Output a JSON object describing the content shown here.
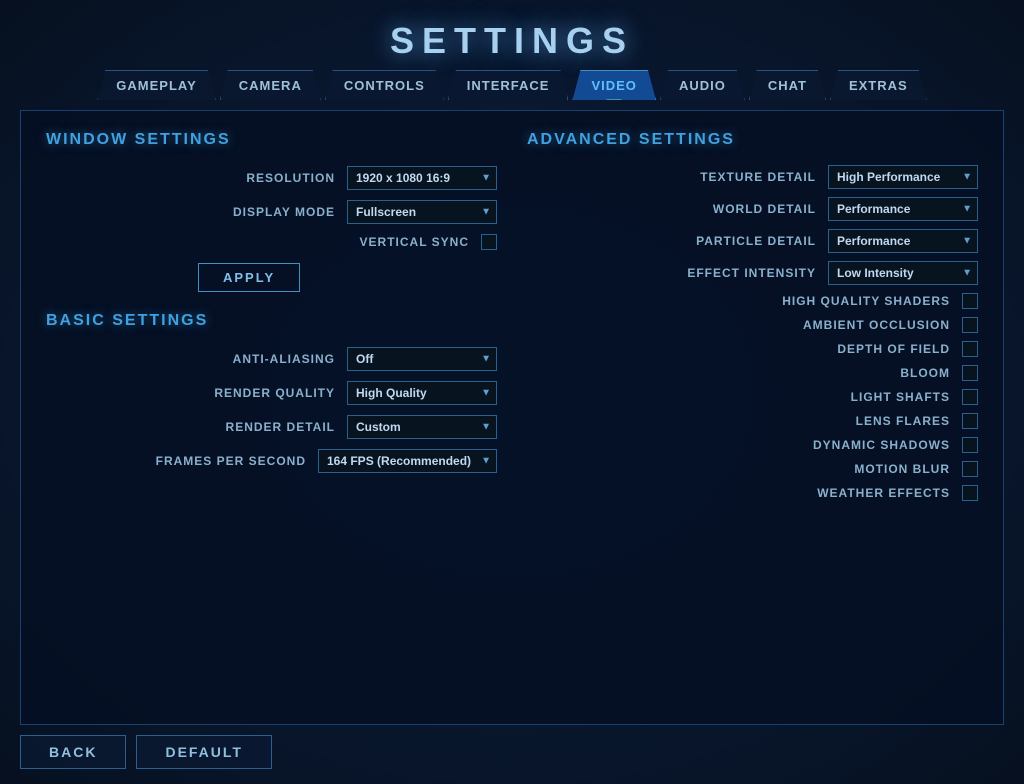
{
  "title": "SETTINGS",
  "tabs": [
    {
      "id": "gameplay",
      "label": "GAMEPLAY",
      "active": false
    },
    {
      "id": "camera",
      "label": "CAMERA",
      "active": false
    },
    {
      "id": "controls",
      "label": "CONTROLS",
      "active": false
    },
    {
      "id": "interface",
      "label": "INTERFACE",
      "active": false
    },
    {
      "id": "video",
      "label": "VIDEO",
      "active": true
    },
    {
      "id": "audio",
      "label": "AUDIO",
      "active": false
    },
    {
      "id": "chat",
      "label": "CHAT",
      "active": false
    },
    {
      "id": "extras",
      "label": "EXTRAS",
      "active": false
    }
  ],
  "windowSettings": {
    "header": "WINDOW SETTINGS",
    "resolution": {
      "label": "RESOLUTION",
      "value": "1920 x 1080 16:9"
    },
    "displayMode": {
      "label": "DISPLAY MODE",
      "value": "Fullscreen"
    },
    "verticalSync": {
      "label": "VERTICAL SYNC",
      "checked": false
    },
    "applyButton": "APPLY"
  },
  "basicSettings": {
    "header": "BASIC SETTINGS",
    "antiAliasing": {
      "label": "ANTI-ALIASING",
      "value": "Off"
    },
    "renderQuality": {
      "label": "RENDER QUALITY",
      "value": "High Quality"
    },
    "renderDetail": {
      "label": "RENDER DETAIL",
      "value": "Custom"
    },
    "framesPerSecond": {
      "label": "FRAMES PER SECOND",
      "value": "164  FPS (Recommended)"
    }
  },
  "advancedSettings": {
    "header": "ADVANCED SETTINGS",
    "textureDetail": {
      "label": "TEXTURE DETAIL",
      "value": "High Performance"
    },
    "worldDetail": {
      "label": "WORLD DETAIL",
      "value": "Performance"
    },
    "particleDetail": {
      "label": "PARTICLE DETAIL",
      "value": "Performance"
    },
    "effectIntensity": {
      "label": "EFFECT INTENSITY",
      "value": "Low Intensity"
    },
    "checkboxes": [
      {
        "id": "high-quality-shaders",
        "label": "HIGH QUALITY SHADERS",
        "checked": false
      },
      {
        "id": "ambient-occlusion",
        "label": "AMBIENT OCCLUSION",
        "checked": false
      },
      {
        "id": "depth-of-field",
        "label": "DEPTH OF FIELD",
        "checked": false
      },
      {
        "id": "bloom",
        "label": "BLOOM",
        "checked": false
      },
      {
        "id": "light-shafts",
        "label": "LIGHT SHAFTS",
        "checked": false
      },
      {
        "id": "lens-flares",
        "label": "LENS FLARES",
        "checked": false
      },
      {
        "id": "dynamic-shadows",
        "label": "DYNAMIC SHADOWS",
        "checked": false
      },
      {
        "id": "motion-blur",
        "label": "MOTION BLUR",
        "checked": false
      },
      {
        "id": "weather-effects",
        "label": "WEATHER EFFECTS",
        "checked": false
      }
    ]
  },
  "bottomButtons": {
    "back": "BACK",
    "default": "DEFAULT"
  }
}
